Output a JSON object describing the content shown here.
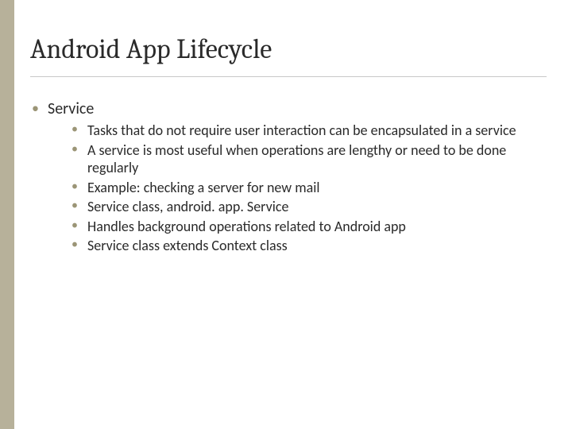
{
  "title": "Android App Lifecycle",
  "top_item": "Service",
  "sub_items": [
    "Tasks that do not require user interaction can be encapsulated in a service",
    "A service is most useful when operations are lengthy or need to be done regularly",
    "Example:  checking a server for new mail",
    "Service class, android. app. Service",
    "Handles background operations related to Android app",
    "Service class extends Context class"
  ]
}
